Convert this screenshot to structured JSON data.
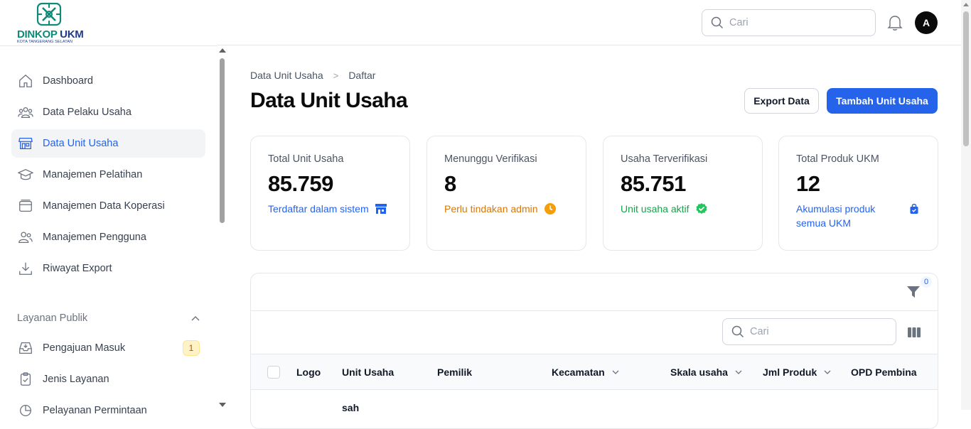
{
  "brand": {
    "name_part1": "DINKOP",
    "name_part2": "UKM",
    "subtitle": "KOTA TANGERANG SELATAN",
    "color_primary": "#0f8a78",
    "color_secondary": "#1e3a8a"
  },
  "sidebar": {
    "items": [
      {
        "label": "Dashboard",
        "icon": "home-icon"
      },
      {
        "label": "Data Pelaku Usaha",
        "icon": "users-icon"
      },
      {
        "label": "Data Unit Usaha",
        "icon": "store-icon",
        "active": true
      },
      {
        "label": "Manajemen Pelatihan",
        "icon": "graduation-cap-icon"
      },
      {
        "label": "Manajemen Data Koperasi",
        "icon": "archive-icon"
      },
      {
        "label": "Manajemen Pengguna",
        "icon": "user-group-icon"
      },
      {
        "label": "Riwayat Export",
        "icon": "download-icon"
      }
    ],
    "section_title": "Layanan Publik",
    "section_items": [
      {
        "label": "Pengajuan Masuk",
        "icon": "inbox-icon",
        "badge": "1"
      },
      {
        "label": "Jenis Layanan",
        "icon": "clipboard-check-icon"
      },
      {
        "label": "Pelayanan Permintaan",
        "icon": "chart-icon"
      }
    ]
  },
  "topbar": {
    "search_placeholder": "Cari",
    "avatar_initial": "A"
  },
  "breadcrumb": {
    "parent": "Data Unit Usaha",
    "separator": ">",
    "current": "Daftar"
  },
  "page": {
    "title": "Data Unit Usaha",
    "export_label": "Export Data",
    "add_label": "Tambah Unit Usaha",
    "accent": "#2563eb"
  },
  "stats": [
    {
      "label": "Total Unit Usaha",
      "value": "85.759",
      "sub": "Terdaftar dalam sistem",
      "tone": "blue",
      "icon": "store-icon"
    },
    {
      "label": "Menunggu Verifikasi",
      "value": "8",
      "sub": "Perlu tindakan admin",
      "tone": "orange",
      "icon": "clock-icon"
    },
    {
      "label": "Usaha Terverifikasi",
      "value": "85.751",
      "sub": "Unit usaha aktif",
      "tone": "green",
      "icon": "check-circle-icon"
    },
    {
      "label": "Total Produk UKM",
      "value": "12",
      "sub": "Akumulasi produk semua UKM",
      "tone": "blue",
      "icon": "shopping-bag-icon"
    }
  ],
  "table": {
    "filter_count": "0",
    "search_placeholder": "Cari",
    "columns": [
      {
        "label": "Logo",
        "sortable": false
      },
      {
        "label": "Unit Usaha",
        "sortable": false
      },
      {
        "label": "Pemilik",
        "sortable": false
      },
      {
        "label": "Kecamatan",
        "sortable": true
      },
      {
        "label": "Skala usaha",
        "sortable": true
      },
      {
        "label": "Jml Produk",
        "sortable": true
      },
      {
        "label": "OPD Pembina",
        "sortable": false
      }
    ],
    "rows_partial": [
      "sah"
    ]
  }
}
